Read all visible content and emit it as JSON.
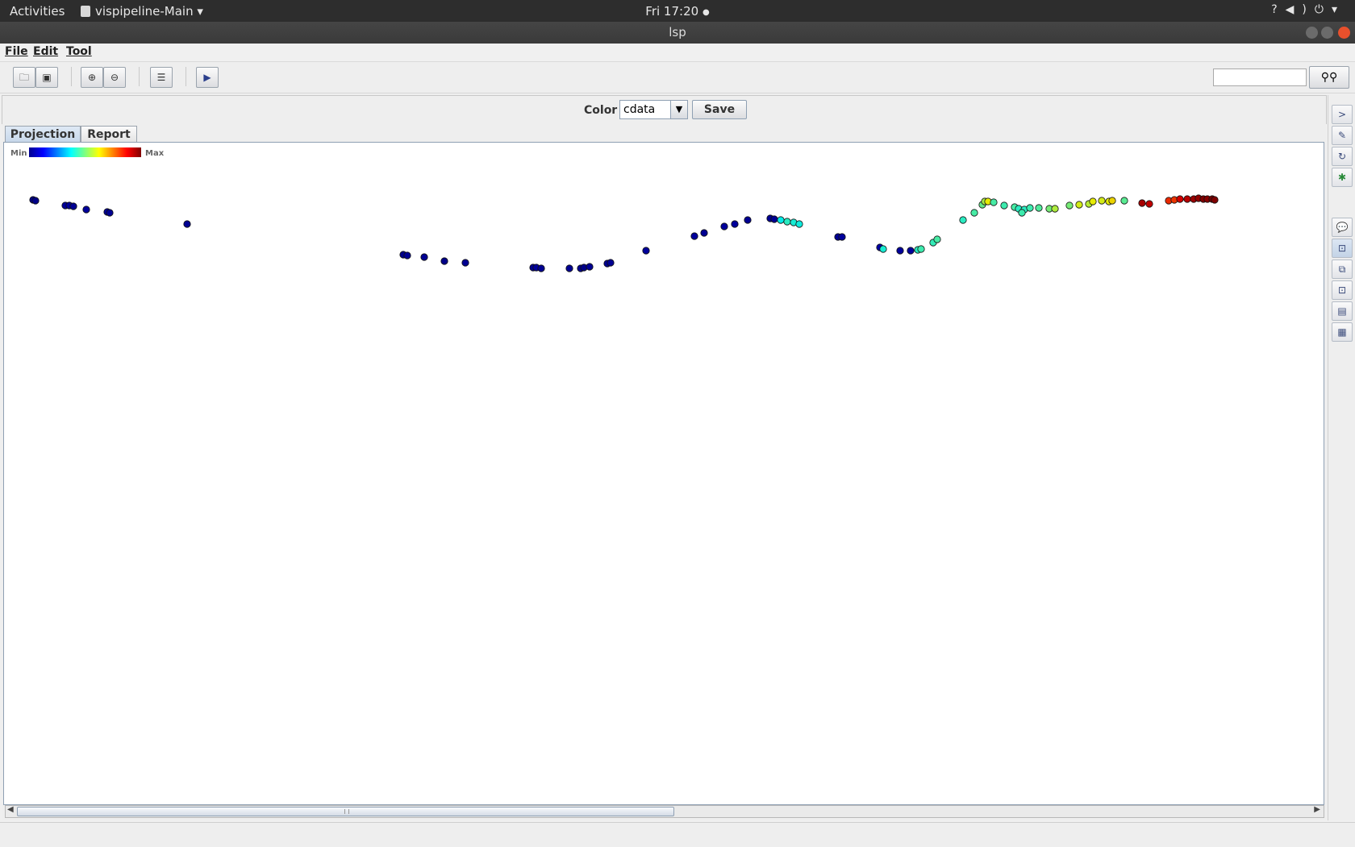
{
  "topbar": {
    "activities": "Activities",
    "app_name": "vispipeline-Main",
    "app_menu_arrow": "▾",
    "clock": "Fri 17:20",
    "clock_dot": "●",
    "tray_icons": [
      "help-icon",
      "volume-icon",
      "power-icon",
      "chevron-down-icon"
    ]
  },
  "window": {
    "title": "lsp"
  },
  "menu": {
    "file": "File",
    "edit": "Edit",
    "tool": "Tool"
  },
  "toolbar": {
    "icons": [
      "open-icon",
      "save-icon",
      "zoom-in-icon",
      "zoom-out-icon",
      "list-icon",
      "play-icon"
    ],
    "search_value": "",
    "find_icon": "binoculars-icon"
  },
  "color_panel": {
    "label": "Color",
    "selected": "cdata",
    "save_label": "Save"
  },
  "tabs": [
    {
      "label": "Projection",
      "selected": true
    },
    {
      "label": "Report",
      "selected": false
    }
  ],
  "legend": {
    "min_label": "Min",
    "max_label": "Max"
  },
  "sidebar_icons": [
    "arrow-right-icon",
    "edit-icon",
    "refresh-icon",
    "tree-icon",
    "speech-bubble-icon",
    "select-icon",
    "copy-icon",
    "frame-icon",
    "table-icon",
    "window-icon"
  ],
  "chart_data": {
    "type": "scatter",
    "colorscale": "jet",
    "x_unit": "screen",
    "points": [
      [
        30,
        71,
        0.02
      ],
      [
        33,
        72,
        0.02
      ],
      [
        70,
        78,
        0.04
      ],
      [
        75,
        78,
        0.04
      ],
      [
        80,
        79,
        0.03
      ],
      [
        96,
        83,
        0.04
      ],
      [
        122,
        86,
        0.04
      ],
      [
        125,
        87,
        0.03
      ],
      [
        221,
        101,
        0.03
      ],
      [
        489,
        139,
        0.02
      ],
      [
        494,
        140,
        0.03
      ],
      [
        515,
        142,
        0.03
      ],
      [
        540,
        147,
        0.02
      ],
      [
        566,
        149,
        0.03
      ],
      [
        650,
        155,
        0.03
      ],
      [
        654,
        155,
        0.04
      ],
      [
        660,
        156,
        0.03
      ],
      [
        695,
        156,
        0.03
      ],
      [
        709,
        156,
        0.03
      ],
      [
        713,
        155,
        0.02
      ],
      [
        720,
        154,
        0.03
      ],
      [
        742,
        150,
        0.03
      ],
      [
        746,
        149,
        0.03
      ],
      [
        790,
        134,
        0.04
      ],
      [
        850,
        116,
        0.04
      ],
      [
        862,
        112,
        0.03
      ],
      [
        887,
        104,
        0.04
      ],
      [
        900,
        101,
        0.04
      ],
      [
        916,
        96,
        0.03
      ],
      [
        944,
        94,
        0.03
      ],
      [
        949,
        95,
        0.03
      ],
      [
        957,
        96,
        0.38
      ],
      [
        965,
        98,
        0.42
      ],
      [
        973,
        99,
        0.4
      ],
      [
        980,
        101,
        0.39
      ],
      [
        1028,
        117,
        0.03
      ],
      [
        1033,
        117,
        0.04
      ],
      [
        1080,
        130,
        0.05
      ],
      [
        1084,
        132,
        0.4
      ],
      [
        1105,
        134,
        0.04
      ],
      [
        1118,
        134,
        0.04
      ],
      [
        1127,
        133,
        0.42
      ],
      [
        1131,
        132,
        0.44
      ],
      [
        1146,
        124,
        0.43
      ],
      [
        1151,
        120,
        0.45
      ],
      [
        1183,
        96,
        0.42
      ],
      [
        1197,
        87,
        0.45
      ],
      [
        1207,
        77,
        0.48
      ],
      [
        1210,
        73,
        0.55
      ],
      [
        1214,
        73,
        0.62
      ],
      [
        1221,
        74,
        0.45
      ],
      [
        1234,
        78,
        0.44
      ],
      [
        1247,
        80,
        0.45
      ],
      [
        1252,
        82,
        0.42
      ],
      [
        1259,
        83,
        0.42
      ],
      [
        1256,
        87,
        0.44
      ],
      [
        1266,
        81,
        0.44
      ],
      [
        1277,
        81,
        0.46
      ],
      [
        1290,
        82,
        0.5
      ],
      [
        1297,
        82,
        0.56
      ],
      [
        1315,
        78,
        0.5
      ],
      [
        1327,
        77,
        0.6
      ],
      [
        1339,
        76,
        0.57
      ],
      [
        1344,
        73,
        0.62
      ],
      [
        1355,
        72,
        0.6
      ],
      [
        1364,
        73,
        0.62
      ],
      [
        1368,
        72,
        0.65
      ],
      [
        1383,
        72,
        0.47
      ],
      [
        1405,
        75,
        0.95
      ],
      [
        1414,
        76,
        0.92
      ],
      [
        1438,
        72,
        0.83
      ],
      [
        1445,
        71,
        0.82
      ],
      [
        1452,
        70,
        0.9
      ],
      [
        1461,
        70,
        0.93
      ],
      [
        1469,
        70,
        0.96
      ],
      [
        1475,
        69,
        0.97
      ],
      [
        1481,
        70,
        0.99
      ],
      [
        1486,
        70,
        0.98
      ],
      [
        1492,
        70,
        1.0
      ],
      [
        1495,
        71,
        0.99
      ]
    ]
  }
}
